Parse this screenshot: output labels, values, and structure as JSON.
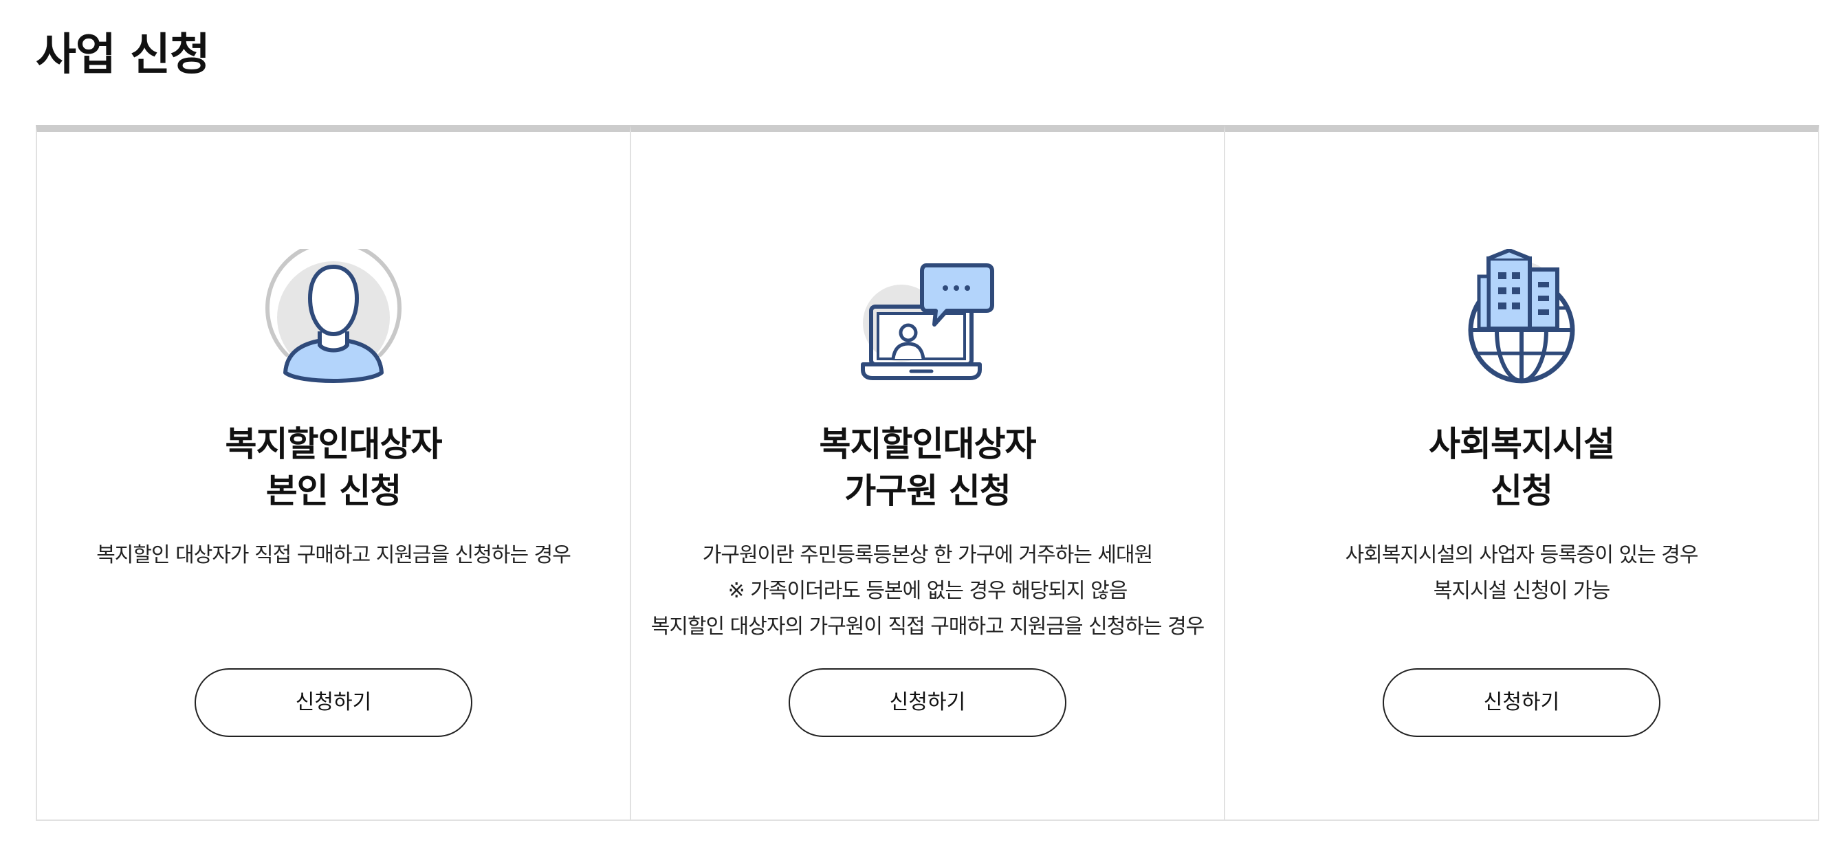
{
  "page": {
    "title": "사업 신청"
  },
  "cards": [
    {
      "icon": "person-avatar-icon",
      "title_lines": [
        "복지할인대상자",
        "본인 신청"
      ],
      "desc_lines": [
        "복지할인 대상자가 직접 구매하고 지원금을 신청하는 경우"
      ],
      "button_label": "신청하기"
    },
    {
      "icon": "laptop-chat-icon",
      "title_lines": [
        "복지할인대상자",
        "가구원 신청"
      ],
      "desc_lines": [
        "가구원이란 주민등록등본상 한 가구에 거주하는 세대원",
        "※ 가족이더라도 등본에 없는 경우 해당되지 않음",
        "복지할인 대상자의 가구원이 직접 구매하고 지원금을 신청하는 경우"
      ],
      "button_label": "신청하기"
    },
    {
      "icon": "building-globe-icon",
      "title_lines": [
        "사회복지시설",
        "신청"
      ],
      "desc_lines": [
        "사회복지시설의 사업자 등록증이 있는 경우",
        "복지시설 신청이 가능"
      ],
      "button_label": "신청하기"
    }
  ],
  "colors": {
    "icon_stroke": "#2f4a7a",
    "icon_fill": "#b3d4fb",
    "icon_bg": "#e6e6e6",
    "card_top_border": "#cccccc",
    "card_border": "#e1e1e1"
  }
}
